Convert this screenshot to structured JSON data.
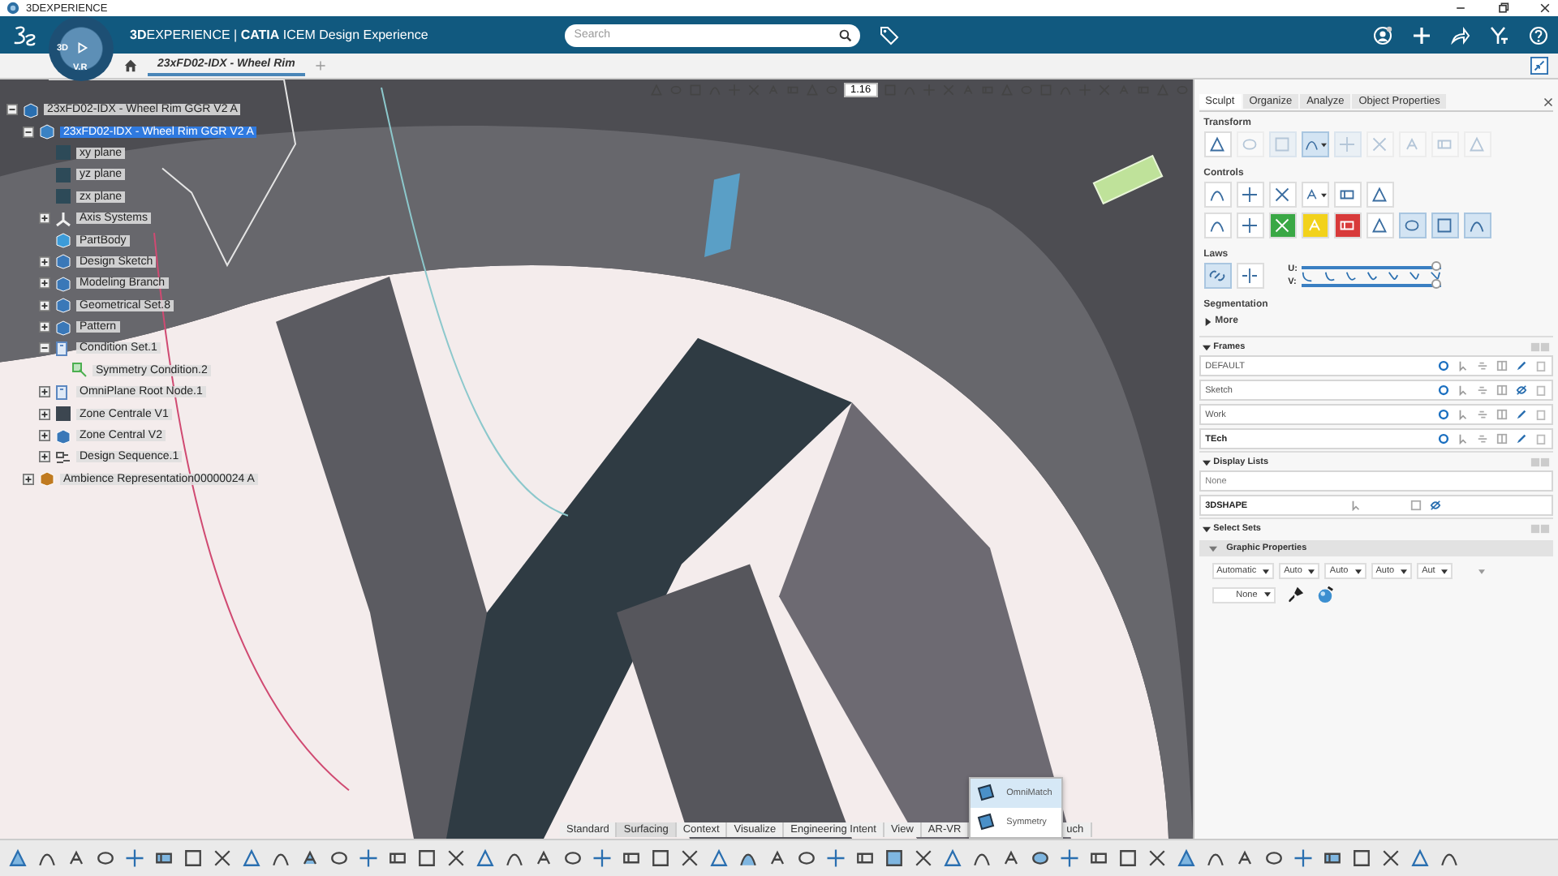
{
  "window": {
    "title": "3DEXPERIENCE"
  },
  "header": {
    "brand": "**3D**EXPERIENCE | **CATIA** ICEM Design Experience",
    "compass": {
      "left": "3D",
      "bottom": "V.R"
    },
    "search": {
      "placeholder": "Search"
    }
  },
  "tabs": [
    {
      "label": "23xFD02-IDX - Wheel Rim",
      "selected": true
    }
  ],
  "viewport_toolbar": {
    "zoom": "1.16"
  },
  "tree": [
    {
      "label": "23xFD02-IDX - Wheel Rim GGR V2 A",
      "kind": "product",
      "selected": false,
      "expanded": true,
      "children": [
        {
          "label": "23xFD02-IDX - Wheel Rim GGR V2 A",
          "kind": "part",
          "selected": true,
          "expanded": true,
          "children": [
            {
              "label": "xy plane",
              "kind": "plane",
              "selected": false
            },
            {
              "label": "yz plane",
              "kind": "plane",
              "selected": false
            },
            {
              "label": "zx plane",
              "kind": "plane",
              "selected": false
            },
            {
              "label": "Axis Systems",
              "kind": "axis",
              "selected": false,
              "expanded": false
            },
            {
              "label": "PartBody",
              "kind": "body",
              "selected": false
            },
            {
              "label": "Design Sketch",
              "kind": "set",
              "selected": false,
              "expanded": false
            },
            {
              "label": "Modeling Branch",
              "kind": "set",
              "selected": false,
              "expanded": false
            },
            {
              "label": "Geometrical Set.8",
              "kind": "set",
              "selected": false,
              "expanded": false
            },
            {
              "label": "Pattern",
              "kind": "set",
              "selected": false,
              "expanded": false
            },
            {
              "label": "Condition Set.1",
              "kind": "condition",
              "selected": false,
              "expanded": true,
              "children": [
                {
                  "label": "Symmetry Condition.2",
                  "kind": "symmetry",
                  "selected": false
                }
              ]
            },
            {
              "label": "OmniPlane Root Node.1",
              "kind": "condition",
              "selected": false,
              "expanded": false
            },
            {
              "label": "Zone Centrale V1",
              "kind": "zone",
              "selected": false,
              "expanded": false
            },
            {
              "label": "Zone Central V2",
              "kind": "set",
              "selected": false,
              "expanded": false
            },
            {
              "label": "Design Sequence.1",
              "kind": "sequence",
              "selected": false,
              "expanded": false
            }
          ]
        },
        {
          "label": "Ambience Representation00000024 A",
          "kind": "ambience",
          "selected": false,
          "expanded": false
        }
      ]
    }
  ],
  "panel": {
    "tabs": [
      {
        "label": "Sculpt",
        "selected": true
      },
      {
        "label": "Organize",
        "selected": false
      },
      {
        "label": "Analyze",
        "selected": false
      },
      {
        "label": "Object Properties",
        "selected": false
      }
    ],
    "transform": {
      "title": "Transform",
      "buttons": [
        {
          "selected": false,
          "disabled": false
        },
        {
          "selected": false,
          "disabled": true
        },
        {
          "selected": true,
          "disabled": true
        },
        {
          "selected": true,
          "disabled": false,
          "has_menu": true
        },
        {
          "selected": true,
          "disabled": true
        },
        {
          "selected": false,
          "disabled": true
        },
        {
          "selected": false,
          "disabled": true
        },
        {
          "selected": false,
          "disabled": true
        },
        {
          "selected": false,
          "disabled": true
        }
      ]
    },
    "controls": {
      "title": "Controls",
      "rows": [
        [
          {
            "selected": false
          },
          {
            "selected": false
          },
          {
            "selected": false
          },
          {
            "selected": false,
            "has_menu": true
          },
          {
            "selected": false
          },
          {
            "selected": false
          }
        ],
        [
          {
            "selected": false
          },
          {
            "selected": false
          },
          {
            "selected": false,
            "color": "#3aa845"
          },
          {
            "selected": false,
            "color": "#f2d21b"
          },
          {
            "selected": false,
            "color": "#d83a3a"
          },
          {
            "selected": false
          },
          {
            "selected": true
          },
          {
            "selected": true
          },
          {
            "selected": true
          }
        ]
      ]
    },
    "laws": {
      "title": "Laws",
      "buttons": [
        {
          "selected": true
        },
        {
          "selected": false
        }
      ],
      "sliders": [
        {
          "label": "U:",
          "level": 1
        },
        {
          "label": "V:",
          "level": 1
        }
      ]
    },
    "segmentation": "Segmentation",
    "more": {
      "label": "More",
      "expanded": false
    },
    "frames": {
      "title": "Frames",
      "expanded": true,
      "rows": [
        {
          "name": "DEFAULT",
          "current": false,
          "hidden": false
        },
        {
          "name": "Sketch",
          "current": false,
          "hidden": true
        },
        {
          "name": "Work",
          "current": false,
          "hidden": false
        },
        {
          "name": "TEch",
          "current": true,
          "hidden": false
        }
      ]
    },
    "display_lists": {
      "title": "Display Lists",
      "expanded": true,
      "rows": [
        {
          "name": "None",
          "kind": "none",
          "current": false
        },
        {
          "name": "3DSHAPE",
          "kind": "shape",
          "current": true
        }
      ]
    },
    "select_sets": {
      "title": "Select Sets",
      "expanded": true
    },
    "graphic_properties": {
      "title": "Graphic Properties",
      "expanded": true,
      "dropdowns": [
        "Automatic",
        "Auto",
        "Auto",
        "Auto",
        "Aut"
      ],
      "fill": "None"
    }
  },
  "command_tabs": [
    {
      "label": "Standard",
      "selected": false
    },
    {
      "label": "Surfacing",
      "selected": true
    },
    {
      "label": "Context",
      "selected": false
    },
    {
      "label": "Visualize",
      "selected": false
    },
    {
      "label": "Engineering Intent",
      "selected": false
    },
    {
      "label": "View",
      "selected": false
    },
    {
      "label": "AR-VR",
      "selected": false
    },
    {
      "label": "uch",
      "selected": false
    }
  ],
  "popup": [
    {
      "label": "OmniMatch",
      "selected": true
    },
    {
      "label": "Symmetry",
      "selected": false
    }
  ]
}
